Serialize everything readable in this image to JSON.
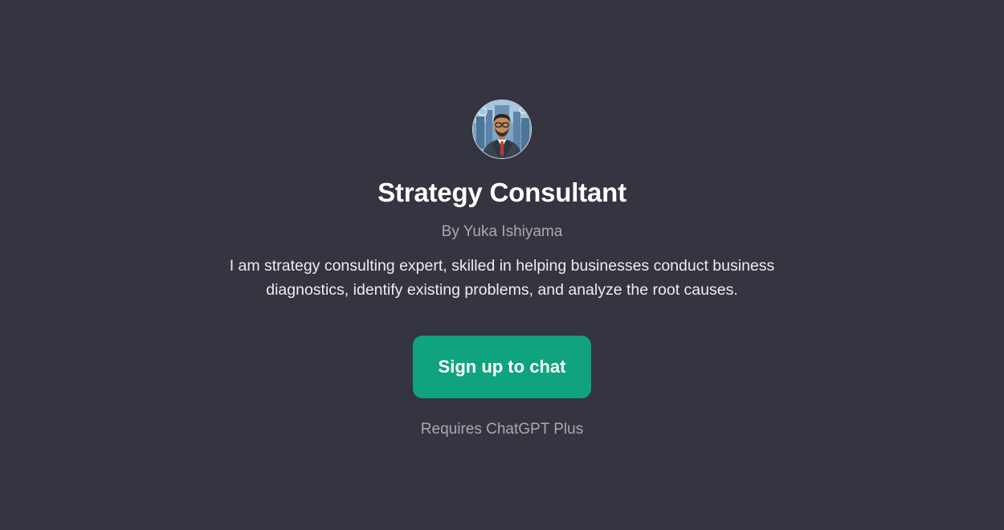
{
  "gpt": {
    "avatar_icon": "consultant-portrait-icon",
    "name": "Strategy Consultant",
    "author": "By Yuka Ishiyama",
    "description": "I am strategy consulting expert, skilled in helping businesses conduct business diagnostics, identify existing problems, and analyze the root causes."
  },
  "cta": {
    "label": "Sign up to chat",
    "color": "#10a37f"
  },
  "note": "Requires ChatGPT Plus",
  "theme": {
    "background": "#343541",
    "text": "#ececf1",
    "muted": "#a9a9b3"
  }
}
